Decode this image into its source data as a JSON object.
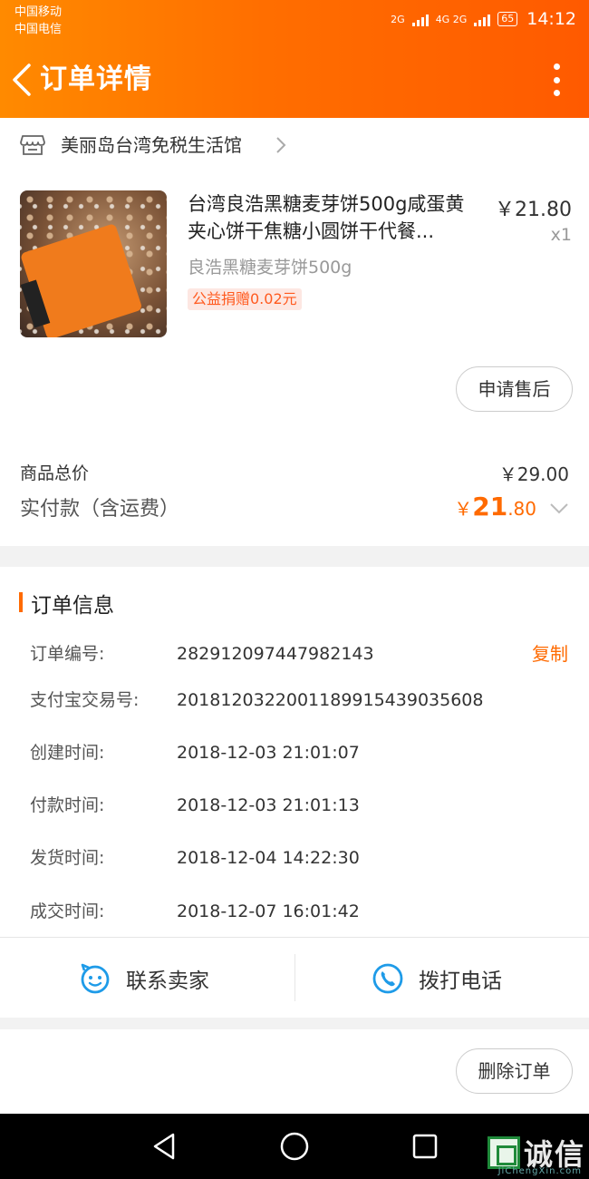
{
  "status_bar": {
    "carrier_1": "中国移动",
    "carrier_2": "中国电信",
    "network_1": "2G",
    "network_2": "4G 2G",
    "battery": "65",
    "time": "14:12"
  },
  "nav": {
    "title": "订单详情",
    "back_icon": "chevron-left-icon",
    "more_icon": "more-vertical-icon"
  },
  "shop": {
    "name": "美丽岛台湾免税生活馆",
    "icon": "store-icon"
  },
  "product": {
    "title": "台湾良浩黑糖麦芽饼500g咸蛋黄夹心饼干焦糖小圆饼干代餐...",
    "price": "￥21.80",
    "quantity": "x1",
    "sku": "良浩黑糖麦芽饼500g",
    "charity_badge": "公益捐赠0.02元"
  },
  "buttons": {
    "after_sale": "申请售后",
    "delete_order": "删除订单"
  },
  "summary": {
    "total_label": "商品总价",
    "total_value": "￥29.00",
    "paid_label": "实付款（含运费）",
    "paid_currency": "￥",
    "paid_integer": "21",
    "paid_decimal": ".80"
  },
  "order_info": {
    "section_title": "订单信息",
    "copy_label": "复制",
    "rows": [
      {
        "label": "订单编号:",
        "value": "282912097447982143"
      },
      {
        "label": "支付宝交易号:",
        "value": "2018120322001189915439035608"
      },
      {
        "label": "创建时间:",
        "value": "2018-12-03 21:01:07"
      },
      {
        "label": "付款时间:",
        "value": "2018-12-03 21:01:13"
      },
      {
        "label": "发货时间:",
        "value": "2018-12-04 14:22:30"
      },
      {
        "label": "成交时间:",
        "value": "2018-12-07 16:01:42"
      }
    ]
  },
  "actions": {
    "contact_seller": "联系卖家",
    "call_phone": "拨打电话"
  },
  "watermark": {
    "text": "诚信",
    "sub": "JiChengXin.com"
  },
  "colors": {
    "accent": "#ff6a00",
    "header_start": "#ff8a00",
    "header_end": "#ff5a00",
    "link_blue": "#1e9be8"
  }
}
